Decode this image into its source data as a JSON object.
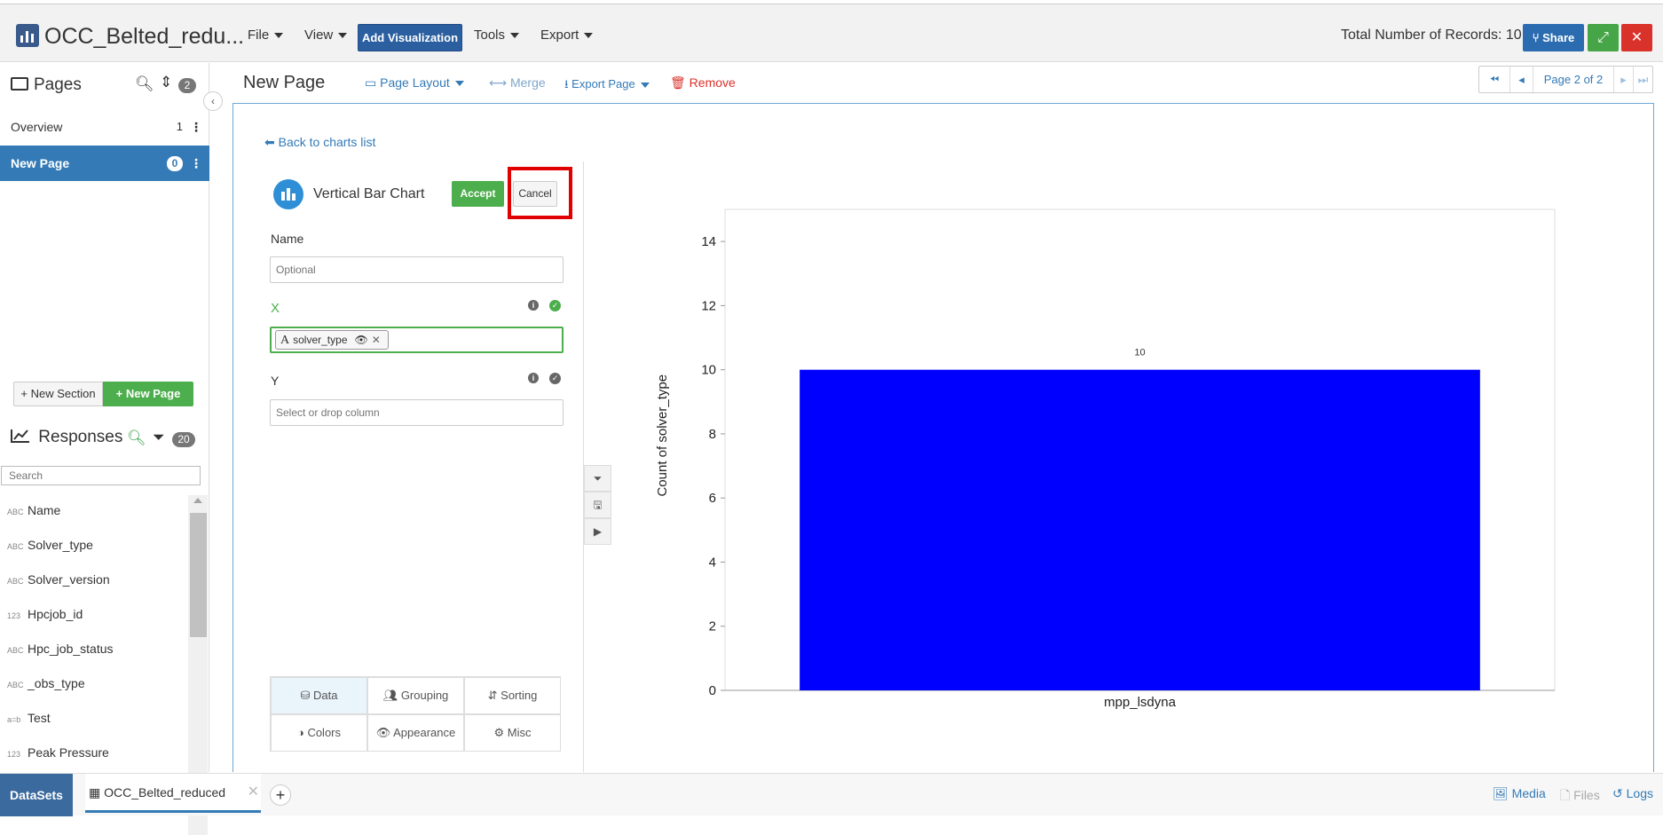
{
  "app": {
    "title": "OCC_Belted_redu...",
    "records_label": "Total Number of Records: 10"
  },
  "menu": {
    "file": "File",
    "view": "View",
    "add_visualization": "Add Visualization",
    "tools": "Tools",
    "export": "Export"
  },
  "header_buttons": {
    "share": "Share"
  },
  "sidebar": {
    "pages_title": "Pages",
    "pages_count": "2",
    "pages": [
      {
        "label": "Overview",
        "count": "1"
      },
      {
        "label": "New Page",
        "count": "0"
      }
    ],
    "new_section": "New Section",
    "new_page": "New Page",
    "responses_title": "Responses",
    "responses_count": "20",
    "search_placeholder": "Search",
    "responses": [
      {
        "type": "ABC",
        "label": "Name"
      },
      {
        "type": "ABC",
        "label": "Solver_type"
      },
      {
        "type": "ABC",
        "label": "Solver_version"
      },
      {
        "type": "123",
        "label": "Hpcjob_id"
      },
      {
        "type": "ABC",
        "label": "Hpc_job_status"
      },
      {
        "type": "ABC",
        "label": "_obs_type"
      },
      {
        "type": "a=b",
        "label": "Test"
      },
      {
        "type": "123",
        "label": "Peak Pressure"
      }
    ]
  },
  "page_toolbar": {
    "title": "New Page",
    "page_layout": "Page Layout",
    "merge": "Merge",
    "export_page": "Export Page",
    "remove": "Remove",
    "pager_label": "Page 2 of 2"
  },
  "editor": {
    "back_link": "Back to charts list",
    "chart_type": "Vertical Bar Chart",
    "accept": "Accept",
    "cancel": "Cancel",
    "name_label": "Name",
    "name_placeholder": "Optional",
    "x_label": "X",
    "x_chip_type": "A",
    "x_chip_value": "solver_type",
    "y_label": "Y",
    "y_placeholder": "Select or drop column",
    "tabs": [
      {
        "label": "Data"
      },
      {
        "label": "Grouping"
      },
      {
        "label": "Sorting"
      },
      {
        "label": "Colors"
      },
      {
        "label": "Appearance"
      },
      {
        "label": "Misc"
      }
    ]
  },
  "chart_data": {
    "type": "bar",
    "categories": [
      "mpp_lsdyna"
    ],
    "values": [
      10
    ],
    "data_labels": [
      "10"
    ],
    "xlabel": "",
    "ylabel": "Count of solver_type",
    "ylim": [
      0,
      15
    ],
    "yticks": [
      0,
      2,
      4,
      6,
      8,
      10,
      12,
      14
    ],
    "grid": false,
    "bar_color": "#0000ff"
  },
  "footer": {
    "datasets": "DataSets",
    "dataset_tab": "OCC_Belted_reduced",
    "media": "Media",
    "files": "Files",
    "logs": "Logs"
  },
  "colors": {
    "primary": "#337ab7",
    "success": "#4cae4c",
    "danger": "#d9322b",
    "highlight": "#e00000"
  }
}
